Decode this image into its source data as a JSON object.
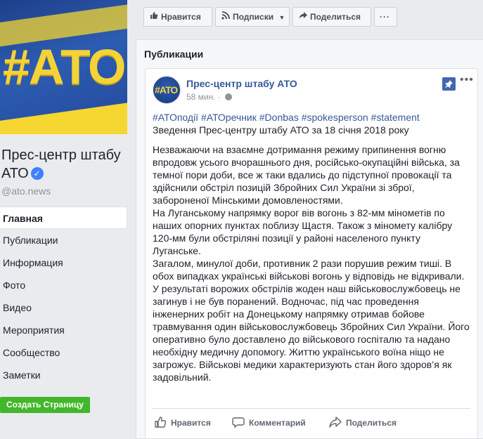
{
  "cover": {
    "logo_text": "#АТО"
  },
  "page": {
    "name": "Прес-центр штабу АТО",
    "verified_symbol": "✓",
    "handle": "@ato.news"
  },
  "nav": {
    "items": [
      {
        "label": "Главная",
        "active": true
      },
      {
        "label": "Публикации",
        "active": false
      },
      {
        "label": "Информация",
        "active": false
      },
      {
        "label": "Фото",
        "active": false
      },
      {
        "label": "Видео",
        "active": false
      },
      {
        "label": "Мероприятия",
        "active": false
      },
      {
        "label": "Сообщество",
        "active": false
      },
      {
        "label": "Заметки",
        "active": false
      }
    ],
    "create_page_label": "Создать Страницу"
  },
  "actions": {
    "like_label": "Нравится",
    "subscribe_label": "Подписки",
    "share_label": "Поделиться",
    "more_label": "···"
  },
  "posts_section": {
    "title": "Публикации"
  },
  "post": {
    "avatar_text": "#АТО",
    "author": "Прес-центр штабу АТО",
    "time": "58 мин.",
    "time_separator": "·",
    "menu_label": "•••",
    "pin_symbol": "📌",
    "hashtags": "#АТОподії #АТОречник #Donbas #spokesperson #statement",
    "heading": "Зведення Прес-центру штабу АТО за 18 січня 2018 року",
    "paragraphs": [
      "Незважаючи на взаємне дотримання режиму припинення вогню впродовж усього вчорашнього дня, російсько-окупаційні війська, за темної пори доби, все ж таки вдались до підступної провокації та здійснили обстріл позицій Збройних Сил України зі зброї, забороненої Мінськими домовленостями.",
      "На Луганському напрямку ворог вів вогонь з 82-мм мінометів по наших опорних пунктах поблизу Щастя. Також з міномету калібру 120-мм були обстріляні позиції у районі населеного пункту Луганське.",
      "Загалом, минулої доби, противник 2 рази порушив режим тиші. В обох випадках українські військові вогонь у відповідь не відкривали. У результаті ворожих обстрілів жоден наш військовослужбовець не загинув і не був поранений. Водночас, під час проведення інженерних робіт на Донецькому напрямку отримав бойове травмування один військовослужбовець Збройних Сил України. Його оперативно було доставлено до військового госпіталю та надано необхідну медичну допомогу. Життю українського воїна ніщо не загрожує. Військові медики характеризують стан його здоров’я як задовільний."
    ],
    "like_label": "Нравится",
    "comment_label": "Комментарий",
    "share_label": "Поделиться"
  },
  "colors": {
    "link": "#365899",
    "accent": "#4267b2",
    "create_button": "#42b72a",
    "background": "#e9ebee"
  }
}
